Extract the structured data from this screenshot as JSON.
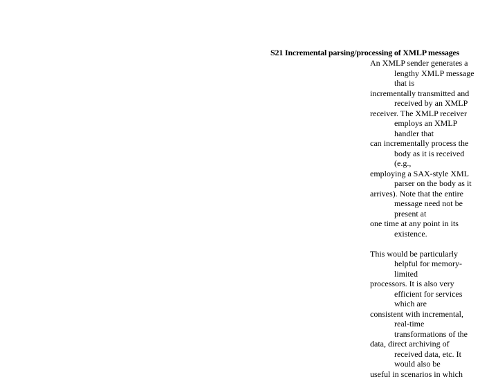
{
  "heading": "S21 Incremental parsing/processing of XMLP messages",
  "paragraphs": [
    {
      "lines": [
        {
          "text": "An XMLP sender generates a",
          "indent": false
        },
        {
          "text": "lengthy XMLP message",
          "indent": true
        },
        {
          "text": "that is",
          "indent": true
        },
        {
          "text": "incrementally transmitted and",
          "indent": false
        },
        {
          "text": "received by an XMLP",
          "indent": true
        },
        {
          "text": "receiver. The XMLP receiver",
          "indent": false
        },
        {
          "text": "employs an XMLP",
          "indent": true
        },
        {
          "text": "handler that",
          "indent": true
        },
        {
          "text": "can incrementally process the",
          "indent": false
        },
        {
          "text": "body as it is received",
          "indent": true
        },
        {
          "text": "(e.g.,",
          "indent": true
        },
        {
          "text": "employing a SAX-style XML",
          "indent": false
        },
        {
          "text": "parser on the body as it",
          "indent": true
        },
        {
          "text": "arrives). Note that the entire",
          "indent": false
        },
        {
          "text": "message need not be",
          "indent": true
        },
        {
          "text": "present at",
          "indent": true
        },
        {
          "text": "one time at any point in its",
          "indent": false
        },
        {
          "text": "existence.",
          "indent": true
        }
      ]
    },
    {
      "lines": [
        {
          "text": "This would be particularly",
          "indent": false
        },
        {
          "text": "helpful for memory-",
          "indent": true
        },
        {
          "text": "limited",
          "indent": true
        },
        {
          "text": "processors. It is also very",
          "indent": false
        },
        {
          "text": "efficient for services",
          "indent": true
        },
        {
          "text": "which are",
          "indent": true
        },
        {
          "text": "consistent with incremental,",
          "indent": false
        },
        {
          "text": "real-time",
          "indent": true
        },
        {
          "text": "transformations of the",
          "indent": true
        },
        {
          "text": "data, direct archiving of",
          "indent": false
        },
        {
          "text": "received data, etc. It",
          "indent": true
        },
        {
          "text": "would also be",
          "indent": true
        },
        {
          "text": "useful in scenarios in which",
          "indent": false
        }
      ]
    }
  ]
}
